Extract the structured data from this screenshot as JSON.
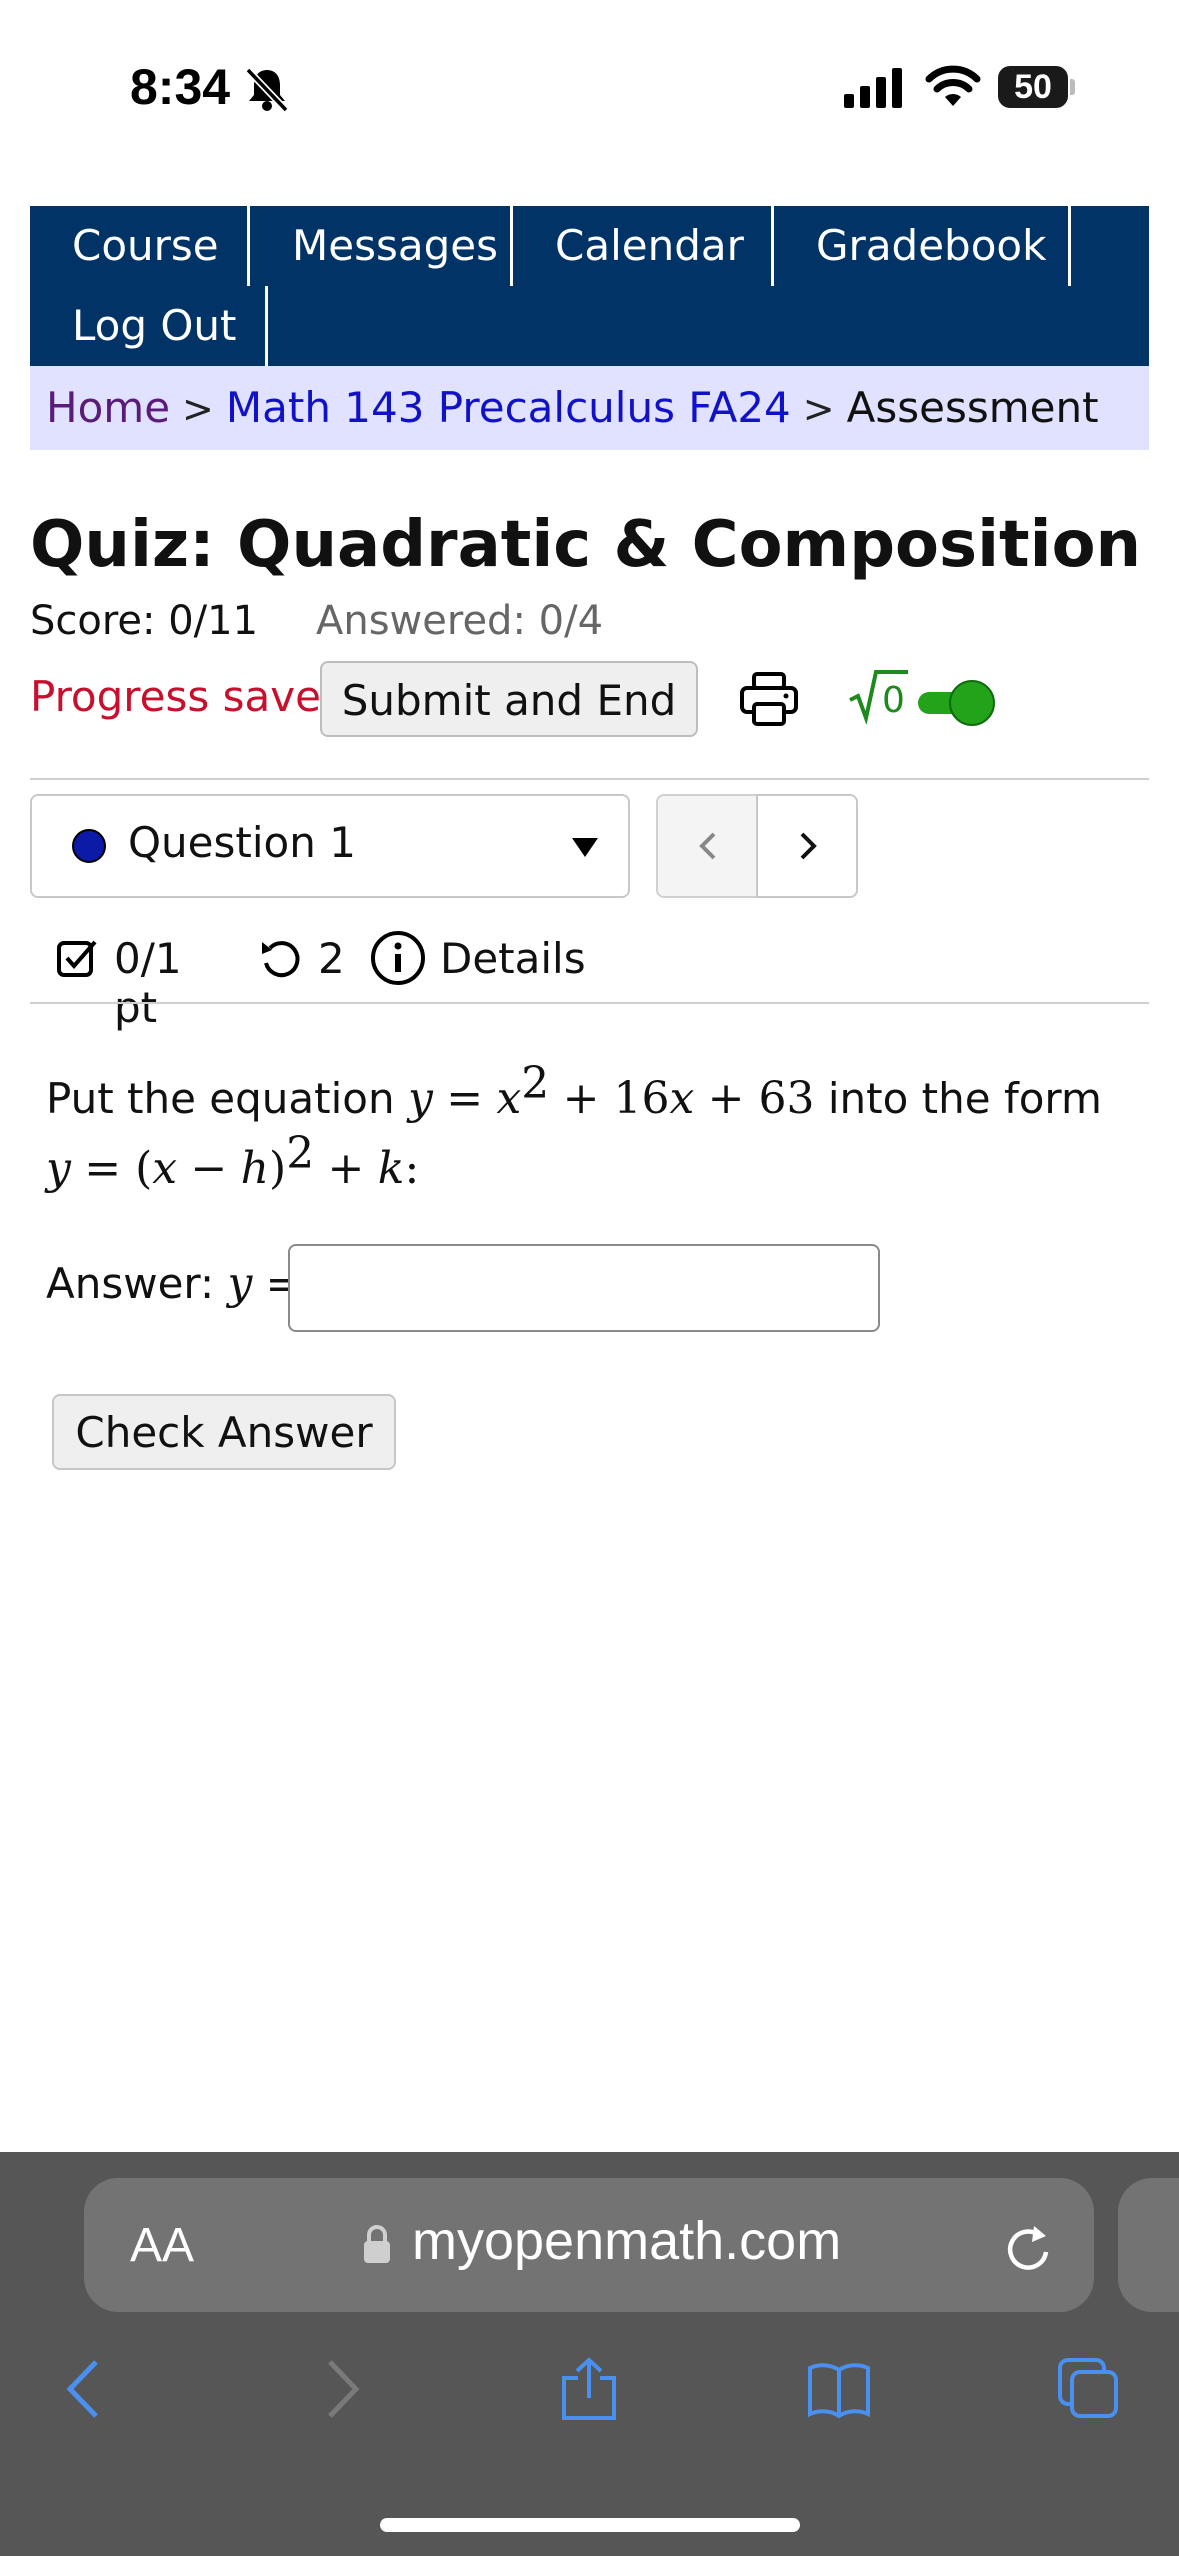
{
  "status_bar": {
    "time": "8:34",
    "battery": "50"
  },
  "nav": {
    "course": "Course",
    "messages": "Messages",
    "calendar": "Calendar",
    "gradebook": "Gradebook",
    "logout": "Log Out"
  },
  "breadcrumb": {
    "home": "Home",
    "sep": ">",
    "course": "Math 143 Precalculus FA24",
    "current": "Assessment"
  },
  "quiz": {
    "title": "Quiz: Quadratic & Composition",
    "score": "Score: 0/11",
    "answered": "Answered: 0/4",
    "progress": "Progress saved",
    "submit_label": "Submit and End",
    "math_toggle_symbol": "√0"
  },
  "question_nav": {
    "selected": "Question 1",
    "points": "0/1 pt",
    "retries": "2",
    "details": "Details"
  },
  "question": {
    "text_prefix": "Put the equation",
    "text_suffix": "into the form",
    "answer_label": "Answer:",
    "answer_value": "",
    "check_label": "Check Answer"
  },
  "browser": {
    "text_size_label": "AA",
    "url": "myopenmath.com"
  },
  "colors": {
    "nav_bg": "#023366",
    "breadcrumb_bg": "#e0e2ff",
    "progress_red": "#c8102e",
    "toggle_green": "#22a31a"
  }
}
